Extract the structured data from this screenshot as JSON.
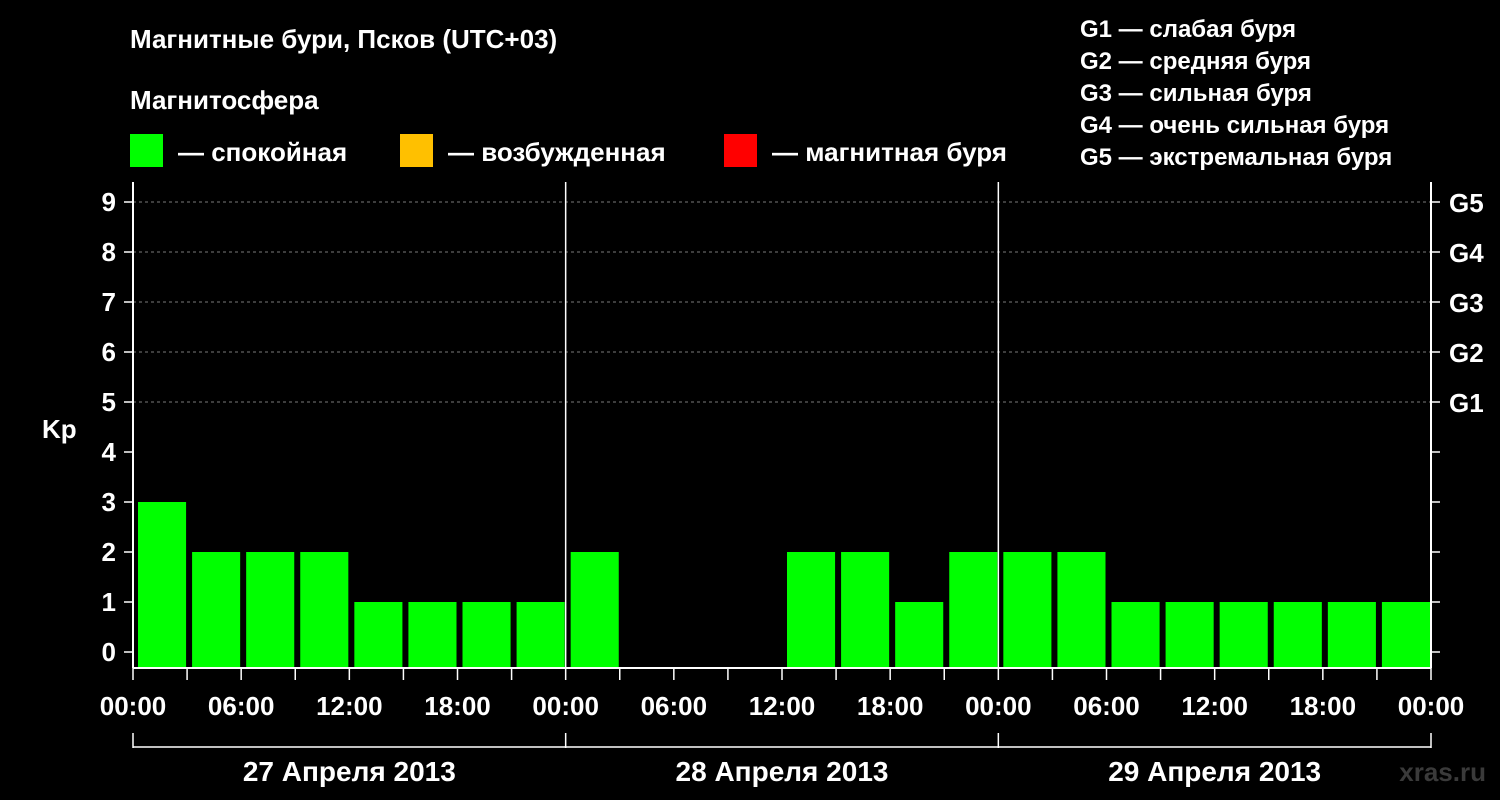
{
  "header": {
    "title": "Магнитные бури, Псков (UTC+03)",
    "subtitle": "Магнитосфера"
  },
  "legend": [
    {
      "label": "— спокойная",
      "color": "#00ff00"
    },
    {
      "label": "— возбужденная",
      "color": "#ffc000"
    },
    {
      "label": "— магнитная буря",
      "color": "#ff0000"
    }
  ],
  "storm_scale": [
    "G1 — слабая буря",
    "G2 — средняя буря",
    "G3 — сильная буря",
    "G4 — очень сильная буря",
    "G5 — экстремальная буря"
  ],
  "watermark": "xras.ru",
  "chart_data": {
    "type": "bar",
    "ylabel": "Kp",
    "ylim": [
      0,
      9
    ],
    "y_ticks": [
      0,
      1,
      2,
      3,
      4,
      5,
      6,
      7,
      8,
      9
    ],
    "right_ticks": [
      {
        "value": 5,
        "label": "G1"
      },
      {
        "value": 6,
        "label": "G2"
      },
      {
        "value": 7,
        "label": "G3"
      },
      {
        "value": 8,
        "label": "G4"
      },
      {
        "value": 9,
        "label": "G5"
      }
    ],
    "x_tick_labels": [
      "00:00",
      "06:00",
      "12:00",
      "18:00",
      "00:00",
      "06:00",
      "12:00",
      "18:00",
      "00:00",
      "06:00",
      "12:00",
      "18:00",
      "00:00"
    ],
    "days": [
      "27 Апреля 2013",
      "28 Апреля 2013",
      "29 Апреля 2013"
    ],
    "bar_interval_hours": 3,
    "values": [
      3,
      2,
      2,
      2,
      1,
      1,
      1,
      1,
      2,
      0,
      0,
      0,
      2,
      2,
      1,
      2,
      2,
      2,
      1,
      1,
      1,
      1,
      1,
      1
    ],
    "bar_color": "#00ff00",
    "grid": "dashed horizontal at 5–9"
  }
}
